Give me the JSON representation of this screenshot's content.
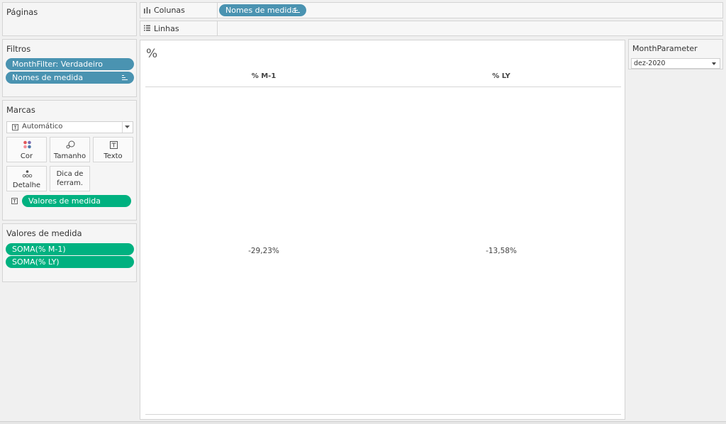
{
  "pages_card": {
    "title": "Páginas"
  },
  "filters_card": {
    "title": "Filtros",
    "pills": [
      {
        "label": "MonthFilter: Verdadeiro"
      },
      {
        "label": "Nomes de medida"
      }
    ]
  },
  "marks_card": {
    "title": "Marcas",
    "mark_type": "Automático",
    "buttons": {
      "color": "Cor",
      "size": "Tamanho",
      "text": "Texto",
      "detail": "Detalhe",
      "tooltip_line1": "Dica de",
      "tooltip_line2": "ferram."
    },
    "text_pill": "Valores de medida"
  },
  "measure_values_card": {
    "title": "Valores de medida",
    "pills": [
      {
        "label": "SOMA(% M-1)"
      },
      {
        "label": "SOMA(% LY)"
      }
    ]
  },
  "shelves": {
    "columns_label": "Colunas",
    "columns_pill": "Nomes de medida",
    "rows_label": "Linhas"
  },
  "view": {
    "title": "%",
    "headers": [
      "% M-1",
      "% LY"
    ],
    "values": [
      "-29,23%",
      "-13,58%"
    ]
  },
  "parameter": {
    "title": "MonthParameter",
    "selected": "dez-2020"
  },
  "colors": {
    "blue_pill": "#4a93b1",
    "green_pill": "#00b180"
  }
}
